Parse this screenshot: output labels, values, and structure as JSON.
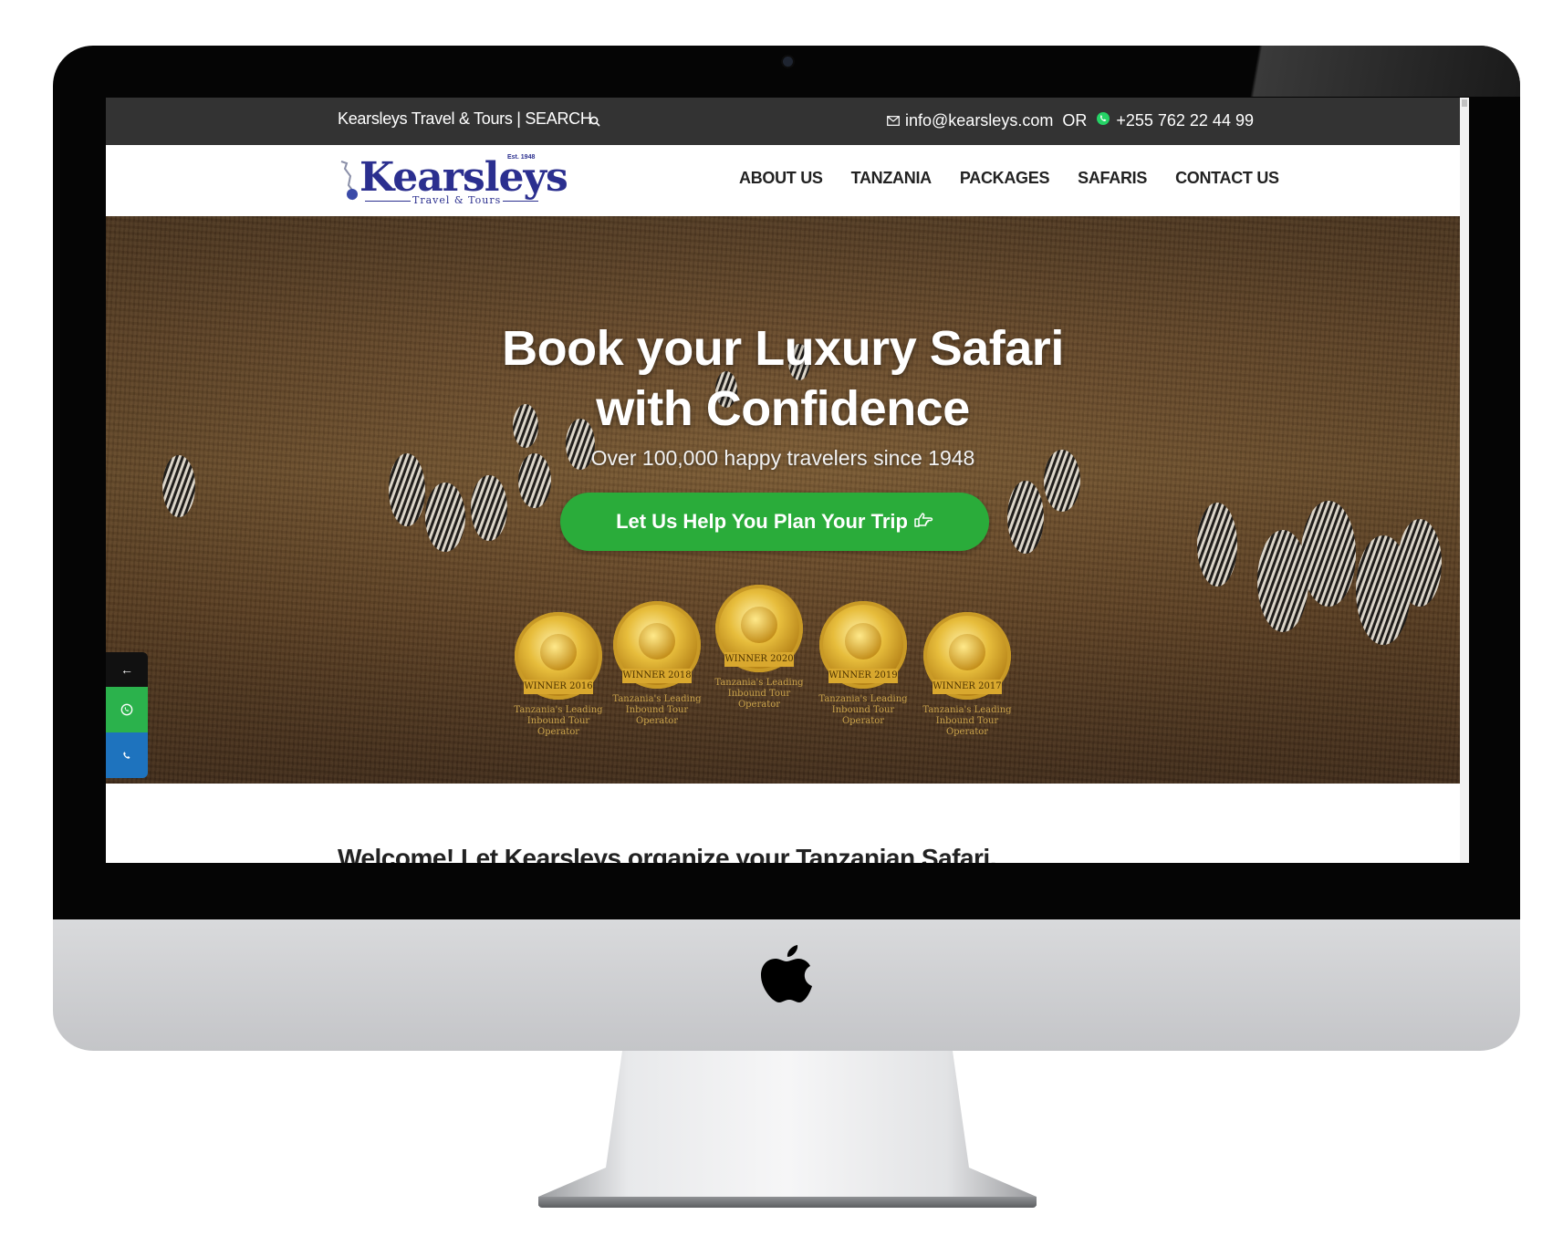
{
  "topbar": {
    "brand_search": "Kearsleys Travel & Tours | SEARCH",
    "email": "info@kearsleys.com",
    "or_label": "OR",
    "phone": "+255 762 22 44 99"
  },
  "logo": {
    "name": "Kearsleys",
    "tagline": "Travel & Tours",
    "est": "Est. 1948"
  },
  "nav": {
    "items": [
      "ABOUT US",
      "TANZANIA",
      "PACKAGES",
      "SAFARIS",
      "CONTACT US"
    ]
  },
  "hero": {
    "title_line1": "Book your Luxury Safari",
    "title_line2": "with Confidence",
    "subtitle": "Over 100,000 happy travelers since 1948",
    "cta_label": "Let Us Help You Plan Your Trip"
  },
  "awards": [
    {
      "ribbon": "WINNER",
      "year": "2016",
      "caption": "Tanzania's Leading Inbound Tour Operator"
    },
    {
      "ribbon": "WINNER",
      "year": "2018",
      "caption": "Tanzania's Leading Inbound Tour Operator"
    },
    {
      "ribbon": "WINNER",
      "year": "2020",
      "caption": "Tanzania's Leading Inbound Tour Operator"
    },
    {
      "ribbon": "WINNER",
      "year": "2019",
      "caption": "Tanzania's Leading Inbound Tour Operator"
    },
    {
      "ribbon": "WINNER",
      "year": "2017",
      "caption": "Tanzania's Leading Inbound Tour Operator"
    }
  ],
  "side": {
    "arrow": "←"
  },
  "welcome": {
    "heading": "Welcome! Let Kearsleys organize your Tanzanian Safari."
  },
  "colors": {
    "topbar": "#333333",
    "brand_blue": "#2b2f8f",
    "cta_green": "#2aac3a",
    "whatsapp_green": "#2bb24c",
    "phone_blue": "#1e73be"
  },
  "icons": [
    "search-icon",
    "envelope-icon",
    "whatsapp-icon",
    "hand-pointer-icon",
    "phone-icon",
    "apple-logo-icon"
  ]
}
